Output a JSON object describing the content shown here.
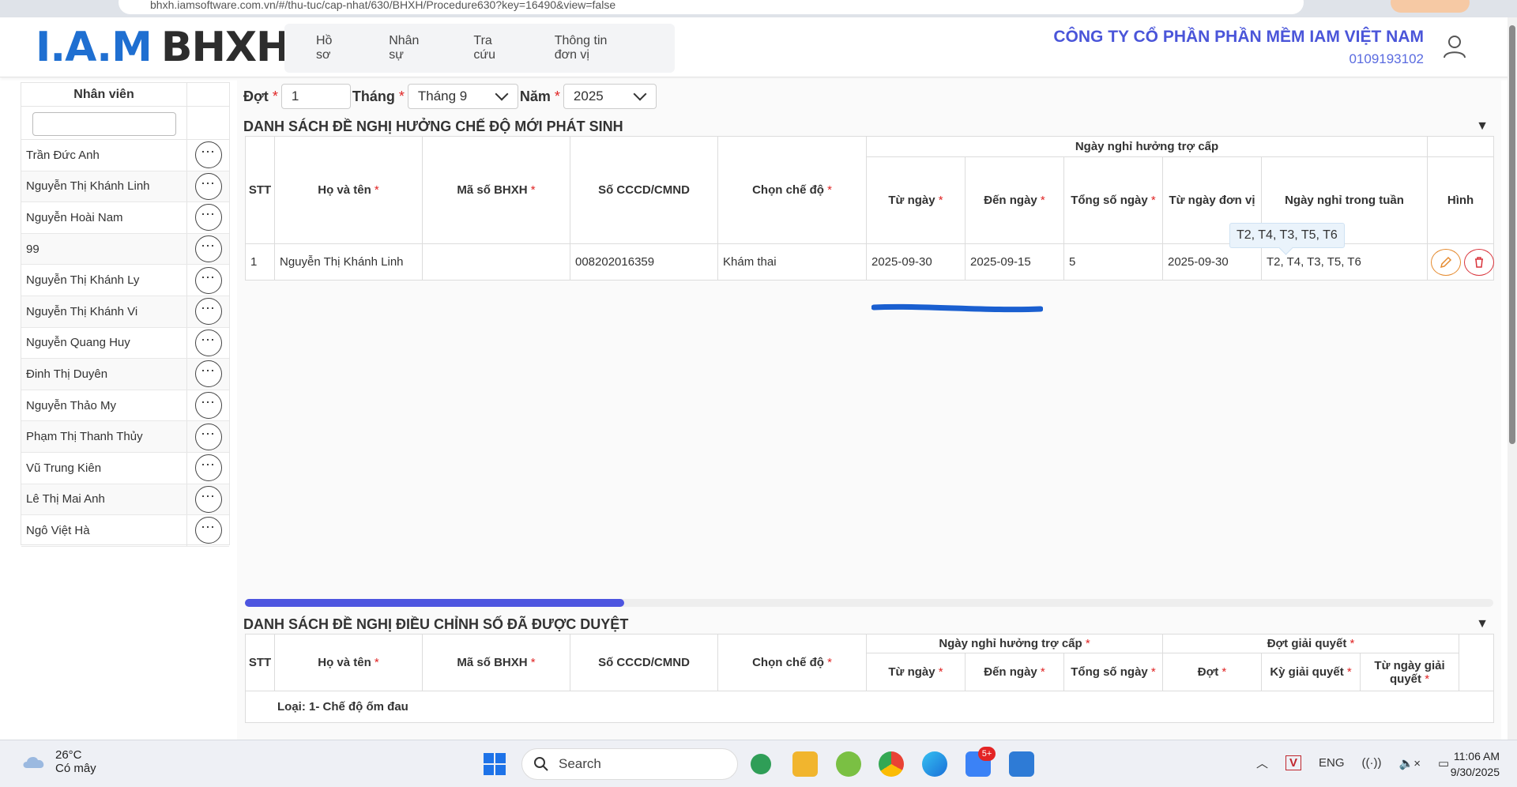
{
  "browser": {
    "url": "bhxh.iamsoftware.com.vn/#/thu-tuc/cap-nhat/630/BHXH/Procedure630?key=16490&view=false"
  },
  "logo": {
    "iam": "I.A.M",
    "bhxh": "BHXH"
  },
  "top_nav": [
    "Hồ sơ",
    "Nhân sự",
    "Tra cứu",
    "Thông tin đơn vị"
  ],
  "company": {
    "name": "CÔNG TY CỔ PHẦN PHẦN MỀM IAM VIỆT NAM",
    "tax_code": "0109193102"
  },
  "sidebar": {
    "header": "Nhân viên",
    "filter_value": "",
    "employees": [
      "Trần Đức Anh",
      "Nguyễn Thị Khánh Linh",
      "Nguyễn Hoài Nam",
      "99",
      "Nguyễn Thị Khánh Ly",
      "Nguyễn Thị Khánh Vi",
      "Nguyễn Quang Huy",
      "Đinh Thị Duyên",
      "Nguyễn Thảo My",
      "Phạm Thị Thanh Thủy",
      "Vũ Trung Kiên",
      "Lê Thị Mai Anh",
      "Ngô Việt Hà"
    ],
    "row_button": "⋯"
  },
  "filters": {
    "dot_label": "Đợt",
    "dot_value": "1",
    "thang_label": "Tháng",
    "thang_value": "Tháng 9",
    "nam_label": "Năm",
    "nam_value": "2025",
    "required_mark": "*"
  },
  "section1": {
    "title": "DANH SÁCH ĐỀ NGHỊ HƯỞNG CHẾ ĐỘ MỚI PHÁT SINH",
    "group_header": "Ngày nghỉ hưởng trợ cấp",
    "columns": {
      "stt": "STT",
      "ho_ten": "Họ và tên",
      "ma_bhxh": "Mã số BHXH",
      "cccd": "Số CCCD/CMND",
      "che_do": "Chọn chế độ",
      "tu_ngay": "Từ ngày",
      "den_ngay": "Đến ngày",
      "tong_so_ngay": "Tổng số ngày",
      "tu_ngay_don_vi": "Từ ngày đơn vị",
      "ngay_nghi_trong_tuan": "Ngày nghỉ trong tuần",
      "hinh": "Hình"
    },
    "rows": [
      {
        "stt": "1",
        "ho_ten": "Nguyễn Thị Khánh Linh",
        "ma_bhxh": "",
        "cccd": "008202016359",
        "che_do": "Khám thai",
        "tu_ngay": "2025-09-30",
        "den_ngay": "2025-09-15",
        "tong_so_ngay": "5",
        "tu_ngay_don_vi": "2025-09-30",
        "ngay_nghi_trong_tuan": "T2, T4, T3, T5, T6"
      }
    ],
    "tooltip": "T2, T4, T3, T5, T6"
  },
  "section2": {
    "title": "DANH SÁCH ĐỀ NGHỊ ĐIỀU CHỈNH SỐ ĐÃ ĐƯỢC DUYỆT",
    "group1": "Ngày nghỉ hưởng trợ cấp",
    "group2": "Đợt giải quyết",
    "columns": {
      "stt": "STT",
      "ho_ten": "Họ và tên",
      "ma_bhxh": "Mã số BHXH",
      "cccd": "Số CCCD/CMND",
      "che_do": "Chọn chế độ",
      "tu_ngay": "Từ ngày",
      "den_ngay": "Đến ngày",
      "tong_so_ngay": "Tổng số ngày",
      "dot": "Đợt",
      "ky_giai_quyet": "Kỳ giải quyết",
      "tu_ngay_giai_quyet": "Từ ngày giải quyết"
    },
    "group_row": "Loại: 1- Chế độ ốm đau"
  },
  "collapse_icon": "▼",
  "taskbar": {
    "temp": "26°C",
    "weather": "Có mây",
    "search": "Search",
    "lang": "ENG",
    "time": "11:06 AM",
    "date": "9/30/2025",
    "badge": "5+"
  }
}
